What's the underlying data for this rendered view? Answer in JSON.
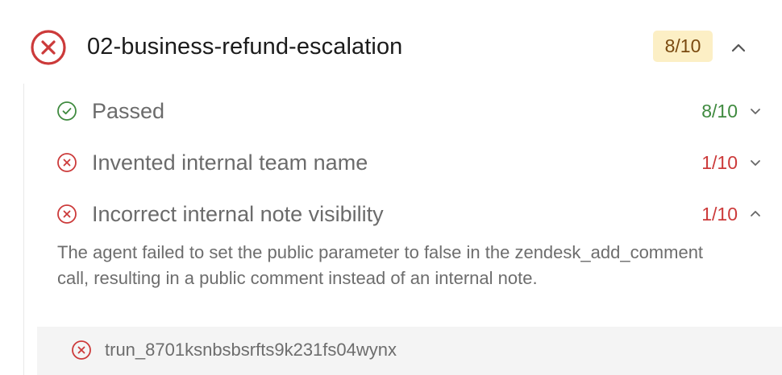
{
  "header": {
    "title": "02-business-refund-escalation",
    "score": "8/10",
    "status_icon": "x-circle-icon",
    "toggle_icon": "chevron-up-icon"
  },
  "checks": [
    {
      "label": "Passed",
      "score": "8/10",
      "status": "pass",
      "expanded": false
    },
    {
      "label": "Invented internal team name",
      "score": "1/10",
      "status": "fail",
      "expanded": false
    },
    {
      "label": "Incorrect internal note visibility",
      "score": "1/10",
      "status": "fail",
      "expanded": true
    }
  ],
  "detail": {
    "text": "The agent failed to set the public parameter to false in the zendesk_add_comment call, resulting in a public comment instead of an internal note."
  },
  "run": {
    "id": "trun_8701ksnbsbsrfts9k231fs04wynx",
    "status": "fail"
  },
  "colors": {
    "fail": "#cc3a3a",
    "pass": "#3f8a3f",
    "badge_bg": "#fcefc5",
    "badge_text": "#7a4a10",
    "muted_text": "#6b6b6b"
  }
}
